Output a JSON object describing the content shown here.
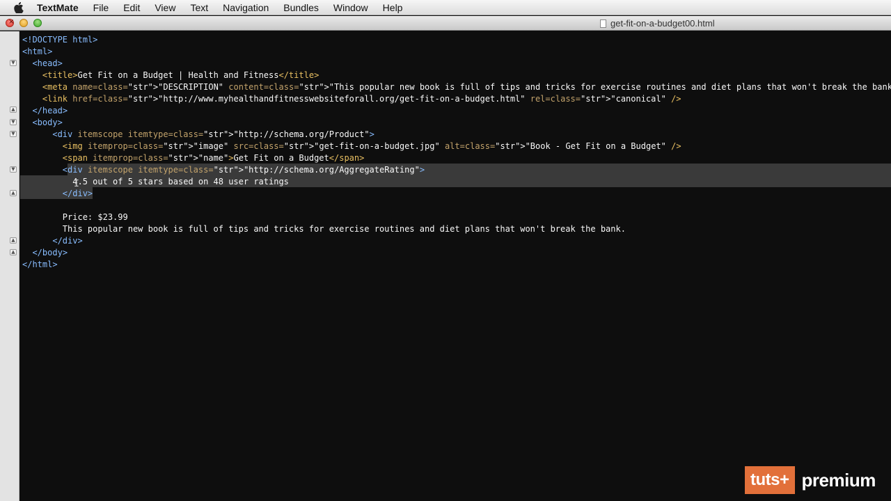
{
  "menubar": {
    "app": "TextMate",
    "items": [
      "File",
      "Edit",
      "View",
      "Text",
      "Navigation",
      "Bundles",
      "Window",
      "Help"
    ]
  },
  "window": {
    "title": "get-fit-on-a-budget00.html"
  },
  "editor": {
    "lines": [
      {
        "t": "<!DOCTYPE html>"
      },
      {
        "t": "<html>"
      },
      {
        "t": "  <head>"
      },
      {
        "t": "    <title>Get Fit on a Budget | Health and Fitness</title>"
      },
      {
        "t": "    <meta name=\"DESCRIPTION\" content=\"This popular new book is full of tips and tricks for exercise routines and diet plans that won't break the bank.\" />"
      },
      {
        "t": "    <link href=\"http://www.myhealthandfitnesswebsiteforall.org/get-fit-on-a-budget.html\" rel=\"canonical\" />"
      },
      {
        "t": "  </head>"
      },
      {
        "t": "  <body>"
      },
      {
        "t": "      <div itemscope itemtype=\"http://schema.org/Product\">"
      },
      {
        "t": "        <img itemprop=\"image\" src=\"get-fit-on-a-budget.jpg\" alt=\"Book - Get Fit on a Budget\" />"
      },
      {
        "t": "        <span itemprop=\"name\">Get Fit on a Budget</span>"
      },
      {
        "t": "        <div itemscope itemtype=\"http://schema.org/AggregateRating\">"
      },
      {
        "t": "          4.5 out of 5 stars based on 48 user ratings"
      },
      {
        "t": "        </div>"
      },
      {
        "t": ""
      },
      {
        "t": "        Price: $23.99"
      },
      {
        "t": "        This popular new book is full of tips and tricks for exercise routines and diet plans that won't break the bank."
      },
      {
        "t": "      </div>"
      },
      {
        "t": "  </body>"
      },
      {
        "t": "</html>"
      }
    ]
  },
  "logo": {
    "badge": "tuts+",
    "text": "premium"
  }
}
